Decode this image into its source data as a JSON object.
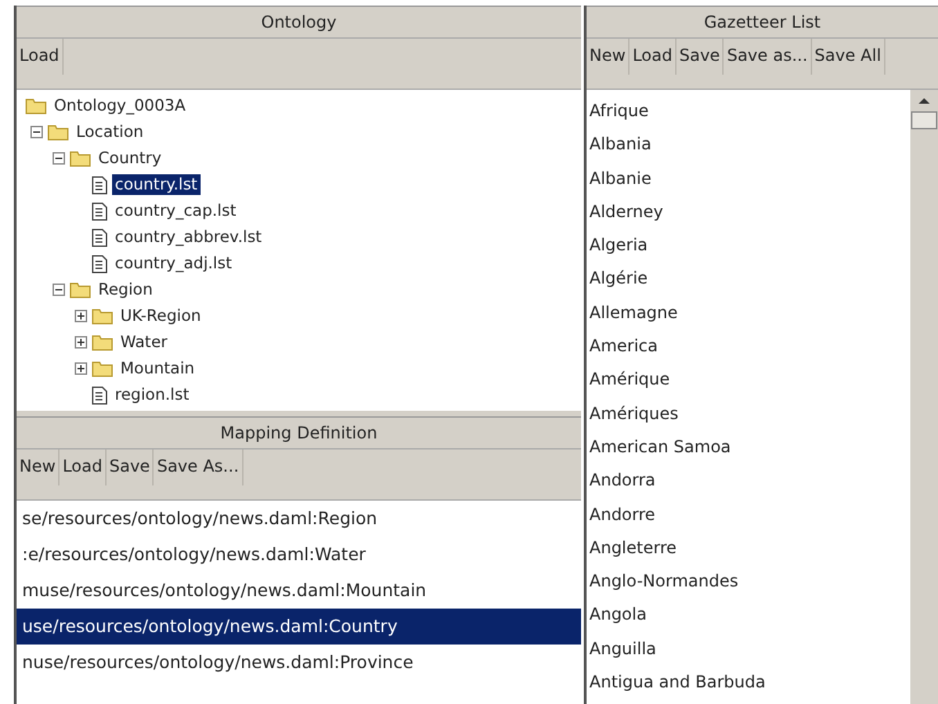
{
  "ontology": {
    "title": "Ontology",
    "buttons": [
      "Load"
    ],
    "tree": [
      {
        "label": "Ontology_0003A",
        "kind": "folder",
        "selected": false,
        "children": [
          {
            "label": "Location",
            "kind": "folder",
            "expanded": true,
            "selected": false,
            "children": [
              {
                "label": "Country",
                "kind": "folder",
                "expanded": true,
                "selected": false,
                "children": [
                  {
                    "label": "country.lst",
                    "kind": "file",
                    "selected": true
                  },
                  {
                    "label": "country_cap.lst",
                    "kind": "file",
                    "selected": false
                  },
                  {
                    "label": "country_abbrev.lst",
                    "kind": "file",
                    "selected": false
                  },
                  {
                    "label": "country_adj.lst",
                    "kind": "file",
                    "selected": false
                  }
                ]
              },
              {
                "label": "Region",
                "kind": "folder",
                "expanded": true,
                "selected": false,
                "children": [
                  {
                    "label": "UK-Region",
                    "kind": "folder",
                    "expanded": false,
                    "selected": false
                  },
                  {
                    "label": "Water",
                    "kind": "folder",
                    "expanded": false,
                    "selected": false
                  },
                  {
                    "label": "Mountain",
                    "kind": "folder",
                    "expanded": false,
                    "selected": false
                  },
                  {
                    "label": "region.lst",
                    "kind": "file",
                    "selected": false
                  }
                ]
              }
            ]
          }
        ]
      }
    ]
  },
  "mapping": {
    "title": "Mapping Definition",
    "buttons": [
      "New",
      "Load",
      "Save",
      "Save As..."
    ],
    "rows": [
      {
        "text": "se/resources/ontology/news.daml:Region",
        "selected": false
      },
      {
        "text": ":e/resources/ontology/news.daml:Water",
        "selected": false
      },
      {
        "text": "muse/resources/ontology/news.daml:Mountain",
        "selected": false
      },
      {
        "text": "use/resources/ontology/news.daml:Country",
        "selected": true
      },
      {
        "text": "nuse/resources/ontology/news.daml:Province",
        "selected": false
      }
    ]
  },
  "gazetteer": {
    "title": "Gazetteer List",
    "buttons": [
      "New",
      "Load",
      "Save",
      "Save as...",
      "Save All"
    ],
    "items": [
      "Afrique",
      "Albania",
      "Albanie",
      "Alderney",
      "Algeria",
      "Algérie",
      "Allemagne",
      "America",
      "Amérique",
      "Amériques",
      "American Samoa",
      "Andorra",
      "Andorre",
      "Angleterre",
      "Anglo-Normandes",
      "Angola",
      "Anguilla",
      "Antigua and Barbuda"
    ]
  }
}
